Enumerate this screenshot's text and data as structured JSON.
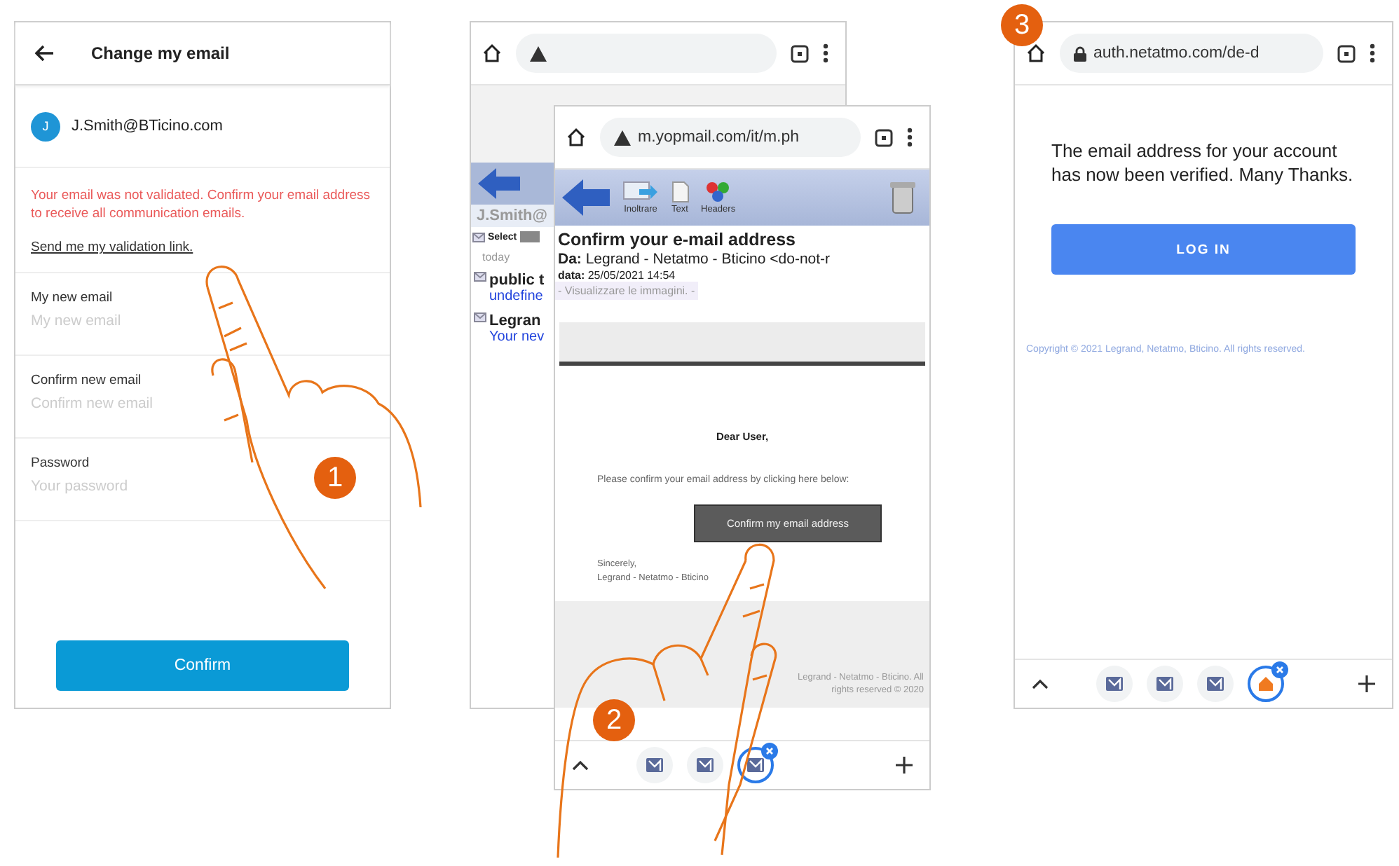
{
  "step1": {
    "badge": "1",
    "title": "Change my email",
    "account": {
      "initial": "J",
      "email": "J.Smith@BTicino.com"
    },
    "warning": "Your email was not validated. Confirm your email address to receive all communication emails.",
    "link": "Send me my validation link.",
    "fields": [
      {
        "label": "My new email",
        "placeholder": "My new email"
      },
      {
        "label": "Confirm new email",
        "placeholder": "Confirm new email"
      },
      {
        "label": "Password",
        "placeholder": "Your password"
      }
    ],
    "button": "Confirm"
  },
  "step2": {
    "badge": "2",
    "back_window": {
      "mailbox": "J.Smith@",
      "select": "Select",
      "day": "today",
      "messages": [
        {
          "sender": "public t",
          "preview": "undefine"
        },
        {
          "sender": "Legran",
          "preview": "Your nev"
        }
      ]
    },
    "front_window": {
      "url": "m.yopmail.com/it/m.ph",
      "tools": [
        {
          "kind": "forward",
          "label": "Inoltrare"
        },
        {
          "kind": "text",
          "label": "Text"
        },
        {
          "kind": "headers",
          "label": "Headers"
        }
      ],
      "subject": "Confirm your e-mail address",
      "from": "**Da:** Legrand - Netatmo - Bticino <do-not-r",
      "date": "**data:** 25/05/2021 14:54",
      "images_link": "- Visualizzare le immagini. -",
      "greeting": "Dear User,",
      "body": "Please confirm your email address by clicking here below:",
      "button": "Confirm my email address",
      "closing": "Sincerely,",
      "signature": "Legrand - Netatmo - Bticino",
      "copyright": "Legrand - Netatmo - Bticino. All rights reserved © 2020",
      "tabs": [
        {
          "kind": "mail",
          "selected": false
        },
        {
          "kind": "mail",
          "selected": false
        },
        {
          "kind": "mail",
          "selected": true
        }
      ]
    }
  },
  "step3": {
    "badge": "3",
    "url": "auth.netatmo.com/de-d",
    "message": "The email address for your account has now been verified. Many Thanks.",
    "button": "LOG IN",
    "copyright": "Copyright © 2021 Legrand, Netatmo, Bticino. All rights reserved.",
    "tabs": [
      {
        "kind": "mail",
        "selected": false
      },
      {
        "kind": "mail",
        "selected": false
      },
      {
        "kind": "mail",
        "selected": false
      },
      {
        "kind": "home",
        "selected": true
      }
    ]
  }
}
